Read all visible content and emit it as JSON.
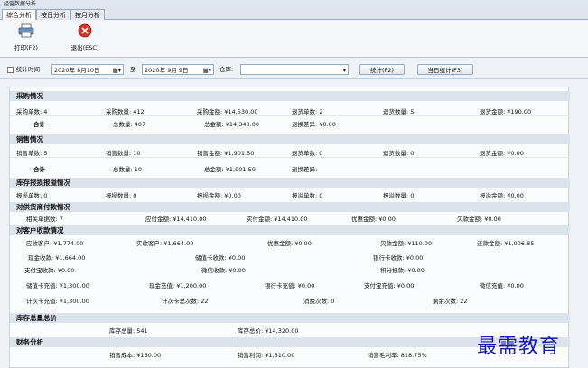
{
  "window": {
    "title": "经营数据分析"
  },
  "tabs": [
    "综合分析",
    "按日分析",
    "按月分析"
  ],
  "toolbar": {
    "print": "打印(F2)",
    "exit": "退出(ESC)"
  },
  "filter": {
    "stat_time": "统计时间",
    "date_from": "2020年 8月10日",
    "to": "至",
    "date_to": "2020年 9月 9日",
    "warehouse_label": "仓库:",
    "warehouse_value": "",
    "stat_btn": "统计(F2)",
    "today_btn": "当日统计(F3)"
  },
  "purchase": {
    "title": "采购情况",
    "r1": [
      "采购单数: 4",
      "采购数量: 412",
      "采购金额: ¥14,530.00",
      "退货单数: 2",
      "退货数量: 5",
      "退货金额: ¥190.00"
    ],
    "r2": [
      "合计",
      "总数量: 407",
      "总金额: ¥14,340.00",
      "退换差异: ¥0.00"
    ]
  },
  "sales": {
    "title": "销售情况",
    "r1": [
      "销售单数: 5",
      "销售数量: 10",
      "销售金额: ¥1,901.50",
      "退货单数: 0",
      "退货数量: 0",
      "退货金额: ¥0.00"
    ],
    "r2": [
      "合计",
      "总数量: 10",
      "总金额: ¥1,901.50",
      "退换差异:"
    ]
  },
  "stock_loss": {
    "title": "库存报损报溢情况",
    "r1": [
      "报损单数: 0",
      "报损数量: 0",
      "报损金额: ¥0.00",
      "报溢单数: 0",
      "报溢数量: 0",
      "报溢金额: ¥0.00"
    ]
  },
  "supplier": {
    "title": "对供货商付款情况",
    "r1": [
      "相关单据数: 7",
      "应付金额: ¥14,410.00",
      "实付金额: ¥14,410.00",
      "优惠金额: ¥0.00",
      "欠款金额: ¥0.00"
    ]
  },
  "customer": {
    "title": "对客户收款情况",
    "r1": [
      "应收客户: ¥1,774.00",
      "实收客户: ¥1,664.00",
      "优惠金额: ¥0.00",
      "欠款金额:  ¥110.00",
      "还款金额: ¥1,006.85"
    ],
    "r2": [
      "现金收款: ¥1,664.00",
      "储值卡收款: ¥0.00",
      "银行卡收款: ¥0.00"
    ],
    "r3": [
      "支付宝收款: ¥0.00",
      "微信收款: ¥0.00",
      "积分抵款: ¥0.00"
    ],
    "r4": [
      "储值卡充值: ¥1,300.00",
      "现金充值: ¥1,200.00",
      "银行卡充值: ¥0.00",
      "支付宝充值: ¥0.00",
      "微信充值: ¥0.00"
    ],
    "r5": [
      "计次卡充值: ¥1,300.00",
      "计次卡总次数: 22",
      "消费次数: 0",
      "剩余次数: 22"
    ]
  },
  "inventory": {
    "title": "库存总量总价",
    "r1": [
      "库存总量: 541",
      "库存总价: ¥14,320.00"
    ]
  },
  "finance": {
    "title": "财务分析",
    "r1": [
      "销售成本: ¥160.00",
      "销售利润: ¥1,310.00",
      "销售毛利率: 818.75%"
    ]
  },
  "watermark": "最需教育"
}
